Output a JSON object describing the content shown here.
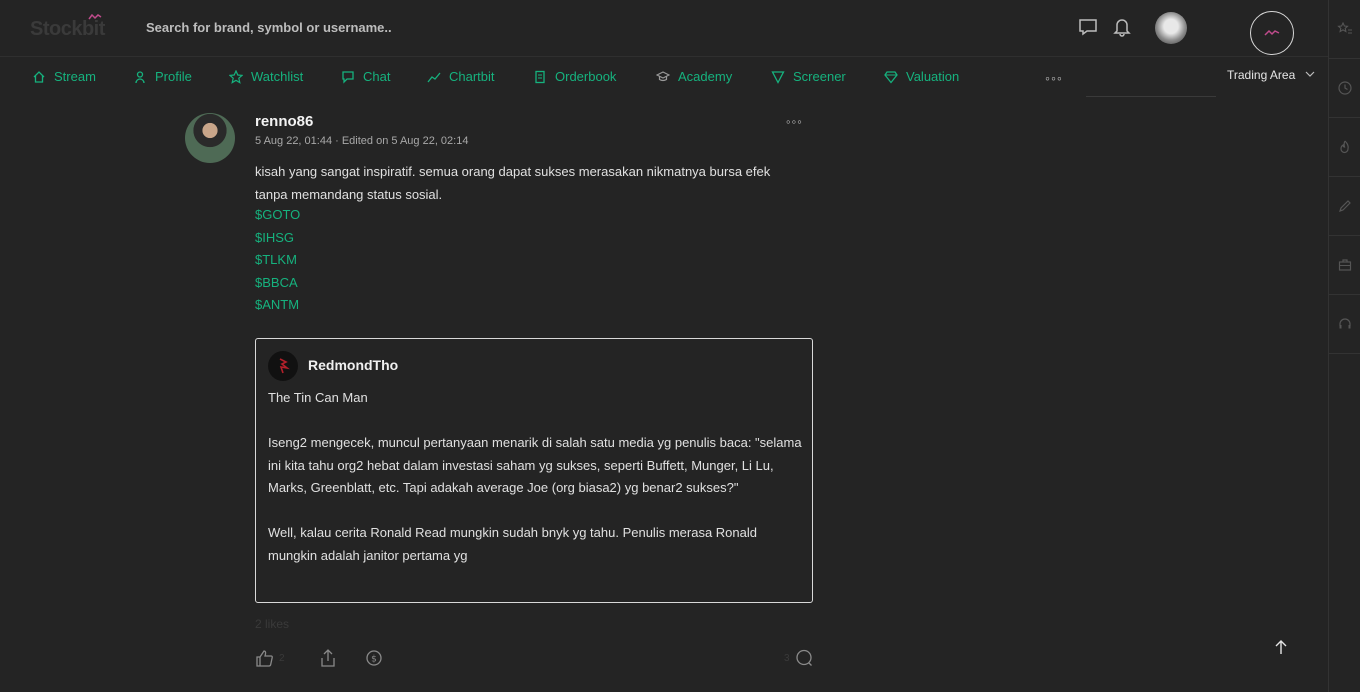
{
  "header": {
    "logo": "Stockbit",
    "search_placeholder": "Search for brand, symbol or username..",
    "trading_area_label": "Trading Area"
  },
  "nav": {
    "items": [
      {
        "label": "Stream",
        "icon": "home-icon"
      },
      {
        "label": "Profile",
        "icon": "user-icon"
      },
      {
        "label": "Watchlist",
        "icon": "star-icon"
      },
      {
        "label": "Chat",
        "icon": "chat-icon"
      },
      {
        "label": "Chartbit",
        "icon": "chart-icon"
      },
      {
        "label": "Orderbook",
        "icon": "document-icon"
      },
      {
        "label": "Academy",
        "icon": "graduation-cap-icon"
      },
      {
        "label": "Screener",
        "icon": "filter-icon"
      },
      {
        "label": "Valuation",
        "icon": "diamond-icon"
      }
    ],
    "more_label": "◦◦◦"
  },
  "post": {
    "username": "renno86",
    "timestamp": "5 Aug 22, 01:44 · Edited on 5 Aug 22, 02:14",
    "body": "kisah yang sangat inspiratif. semua orang dapat sukses merasakan nikmatnya bursa efek tanpa memandang status sosial.",
    "cashtags": [
      "$GOTO",
      "$IHSG",
      "$TLKM",
      "$BBCA",
      "$ANTM"
    ],
    "more_label": "◦◦◦",
    "quote": {
      "username": "RedmondTho",
      "paragraphs": [
        "The Tin Can Man",
        "Iseng2 mengecek, muncul pertanyaan menarik di salah satu media yg penulis baca: \"selama ini kita tahu org2 hebat dalam investasi saham yg sukses, seperti Buffett, Munger, Li Lu, Marks, Greenblatt, etc. Tapi adakah average Joe (org biasa2) yg benar2 sukses?\"",
        "Well, kalau cerita Ronald Read mungkin sudah bnyk yg tahu. Penulis merasa Ronald mungkin adalah janitor pertama yg"
      ]
    },
    "likes_text": "2 likes",
    "like_count": "2",
    "reply_count": "3"
  },
  "colors": {
    "accent": "#16b27e",
    "background": "#242424"
  }
}
